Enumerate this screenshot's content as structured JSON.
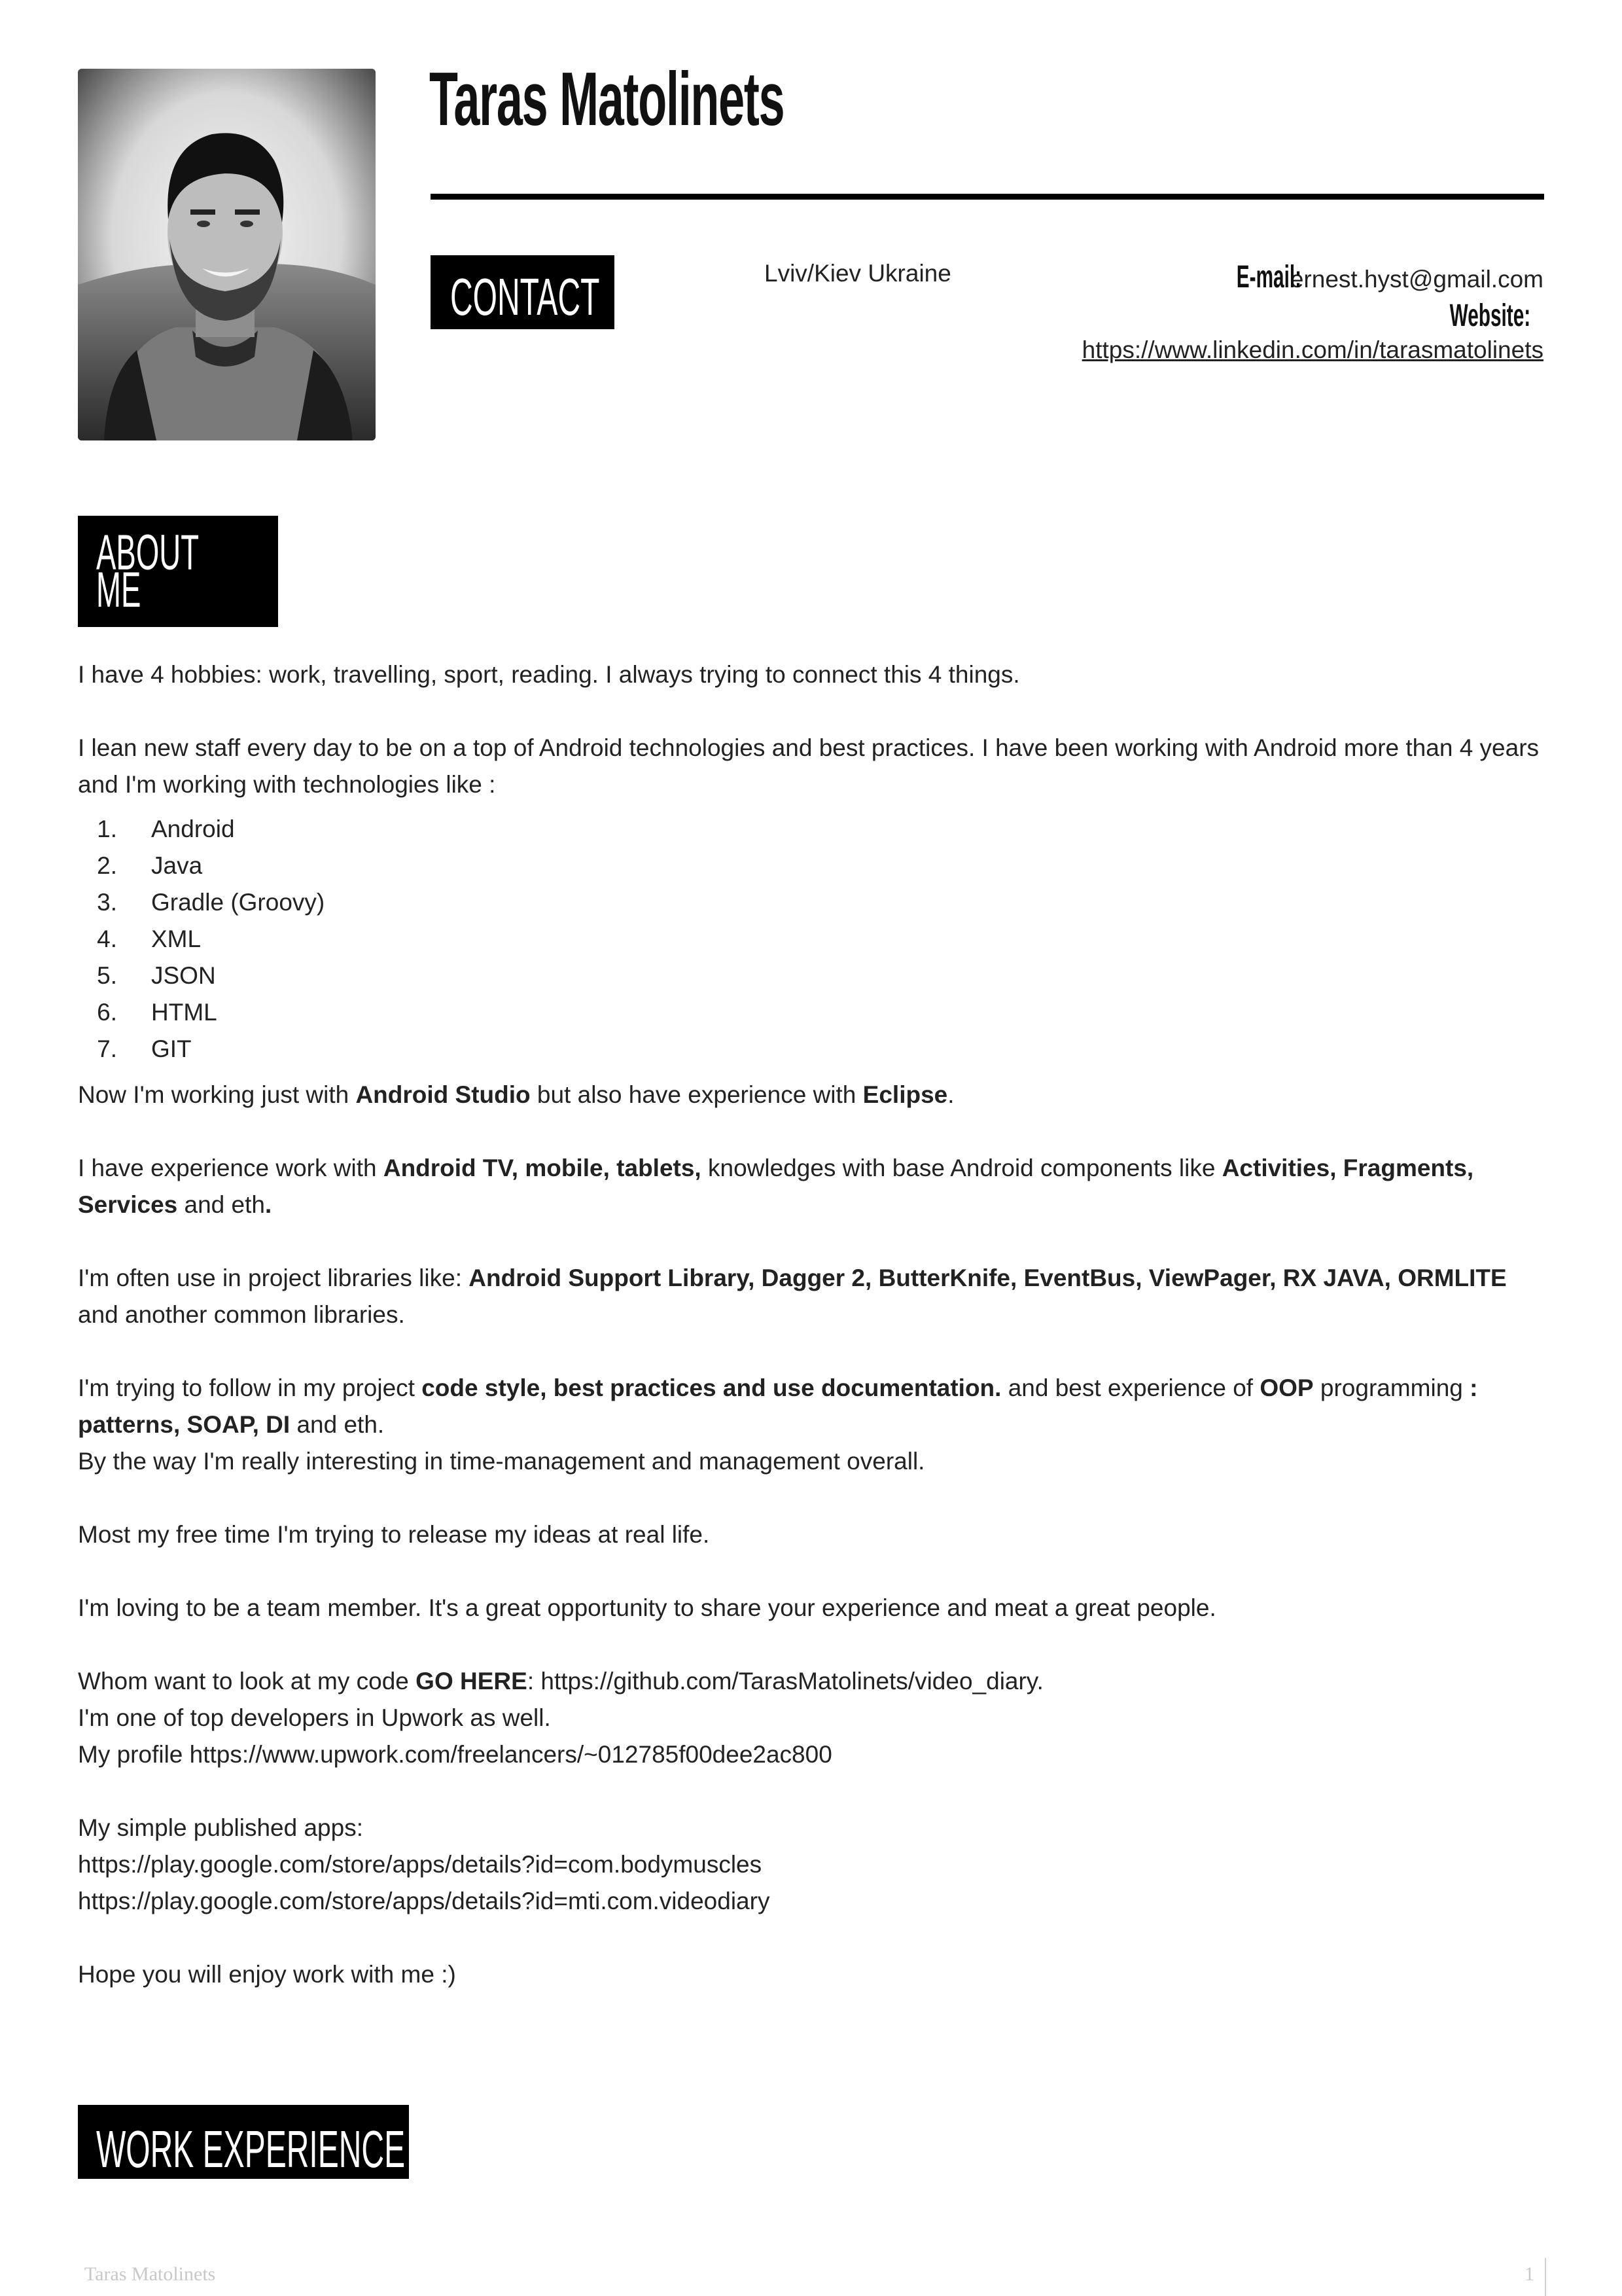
{
  "header": {
    "name": "Taras Matolinets",
    "photo_alt": "Black and white portrait photo"
  },
  "contact": {
    "label": "CONTACT",
    "location": "Lviv/Kiev Ukraine",
    "email_label": "E-mail:",
    "email": "ernest.hyst@gmail.com",
    "website_label": "Website:",
    "website": "https://www.linkedin.com/in/tarasmatolinets"
  },
  "about": {
    "label_line1": "ABOUT",
    "label_line2": "ME",
    "p1": "I have 4 hobbies: work, travelling, sport, reading. I always trying to connect this 4 things.",
    "p2": "I lean new staff every day to be on a top of Android technologies and best practices. I have been working with Android more than 4 years and I'm working with technologies like :",
    "technologies": [
      "Android",
      "Java",
      "Gradle (Groovy)",
      "XML",
      "JSON",
      "HTML",
      "GIT"
    ],
    "p3": {
      "a": "Now I'm working just with ",
      "b1": "Android Studio",
      "c": " but also have experience with ",
      "b2": "Eclipse",
      "d": "."
    },
    "p4": {
      "a": "I have experience work with ",
      "b1": "Android TV, mobile, tablets,",
      "c": " knowledges with base Android components like ",
      "b2": "Activities, Fragments, Services",
      "d": " and eth",
      "e": "."
    },
    "p5": {
      "a": "I'm often use in project libraries like: ",
      "b1": "Android Support Library, Dagger 2, ButterKnife, EventBus, ViewPager, RX JAVA, ORMLITE",
      "c": " and another common libraries."
    },
    "p6": {
      "a": "I'm trying to follow in my project ",
      "b1": "code style, best practices and use documentation.",
      "c": " and best experience of ",
      "b2": "OOP",
      "d": " programming ",
      "b3": ": patterns, SOAP, DI",
      "e": " and eth."
    },
    "p6b": "By the way I'm really interesting in time-management and management overall.",
    "p7": "Most my free time I'm trying to release my ideas at real life.",
    "p8": "I'm loving to be a team member. It's a great opportunity to share your experience and meat a great people.",
    "p9": {
      "a": "Whom want to look at my code ",
      "b1": "GO HERE",
      "c": ": https://github.com/TarasMatolinets/video_diary.",
      "line2": "I'm one of top developers in Upwork as well.",
      "line3": "My profile https://www.upwork.com/freelancers/~012785f00dee2ac800"
    },
    "apps": {
      "title": "My simple published apps:",
      "links": [
        "https://play.google.com/store/apps/details?id=com.bodymuscles",
        "https://play.google.com/store/apps/details?id=mti.com.videodiary"
      ]
    },
    "closing": "Hope you will enjoy work with me :)"
  },
  "work": {
    "label": "WORK EXPERIENCE"
  },
  "footer": {
    "name": "Taras Matolinets",
    "page": "1"
  }
}
